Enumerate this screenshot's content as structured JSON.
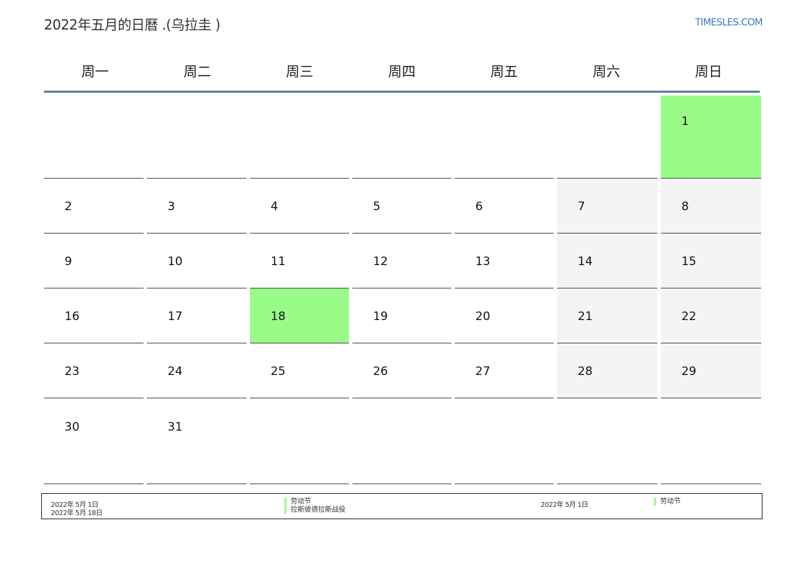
{
  "header": {
    "title": "2022年五月的日曆 .(乌拉圭 )",
    "brand": "TIMESLES.COM"
  },
  "weekdays": [
    "周一",
    "周二",
    "周三",
    "周四",
    "周五",
    "周六",
    "周日"
  ],
  "weeks": [
    [
      "",
      "",
      "",
      "",
      "",
      "",
      "1"
    ],
    [
      "2",
      "3",
      "4",
      "5",
      "6",
      "7",
      "8"
    ],
    [
      "9",
      "10",
      "11",
      "12",
      "13",
      "14",
      "15"
    ],
    [
      "16",
      "17",
      "18",
      "19",
      "20",
      "21",
      "22"
    ],
    [
      "23",
      "24",
      "25",
      "26",
      "27",
      "28",
      "29"
    ],
    [
      "30",
      "31",
      "",
      "",
      "",
      "",
      ""
    ]
  ],
  "holiday_days": [
    "1",
    "18"
  ],
  "colors": {
    "holiday": "#99fb88",
    "weekend": "#f4f4f4",
    "header_rule": "#5b7aa6",
    "brand": "#3a78c2"
  },
  "legend": {
    "left": [
      {
        "date": "2022年 5月 1日",
        "name": "劳动节"
      },
      {
        "date": "2022年 5月 18日",
        "name": "拉斯彼德拉斯战役"
      }
    ],
    "right": [
      {
        "date": "2022年 5月 1日",
        "name": "劳动节"
      }
    ]
  }
}
